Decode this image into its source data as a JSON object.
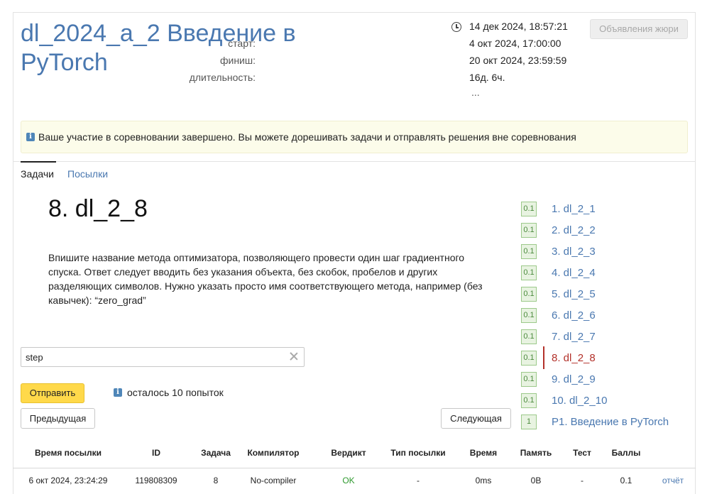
{
  "contest": {
    "title": "dl_2024_a_2 Введение в PyTorch",
    "now": "14 дек 2024, 18:57:21",
    "start_label": "старт:",
    "start": "4 окт 2024, 17:00:00",
    "finish_label": "финиш:",
    "finish": "20 окт 2024, 23:59:59",
    "duration_label": "длительность:",
    "duration": "16д. 6ч.",
    "ellipsis": "...",
    "jury_button": "Объявления жюри"
  },
  "alert": {
    "icon": "info-icon",
    "text": "Ваше участие в соревновании завершено. Вы можете дорешивать задачи и отправлять решения вне соревнования"
  },
  "tabs": {
    "tasks": "Задачи",
    "submissions": "Посылки"
  },
  "problem": {
    "title": "8. dl_2_8",
    "statement": "Впишите название метода оптимизатора, позволяющего провести один шаг градиентного спуска. Ответ следует вводить без указания объекта, без скобок, пробелов и других разделяющих символов. Нужно указать просто имя соответствующего метода, например (без кавычек): “zero_grad”",
    "answer_value": "step",
    "submit_label": "Отправить",
    "attempts_left": "осталось 10 попыток",
    "prev_label": "Предыдущая",
    "next_label": "Следующая"
  },
  "problem_list": [
    {
      "score": "0.1",
      "label": "1. dl_2_1"
    },
    {
      "score": "0.1",
      "label": "2. dl_2_2"
    },
    {
      "score": "0.1",
      "label": "3. dl_2_3"
    },
    {
      "score": "0.1",
      "label": "4. dl_2_4"
    },
    {
      "score": "0.1",
      "label": "5. dl_2_5"
    },
    {
      "score": "0.1",
      "label": "6. dl_2_6"
    },
    {
      "score": "0.1",
      "label": "7. dl_2_7"
    },
    {
      "score": "0.1",
      "label": "8. dl_2_8",
      "active": true
    },
    {
      "score": "0.1",
      "label": "9. dl_2_9"
    },
    {
      "score": "0.1",
      "label": "10. dl_2_10"
    },
    {
      "score": "1",
      "label": "P1. Введение в PyTorch"
    }
  ],
  "submissions_table": {
    "headers": [
      "Время посылки",
      "ID",
      "Задача",
      "Компилятор",
      "Вердикт",
      "Тип посылки",
      "Время",
      "Память",
      "Тест",
      "Баллы"
    ],
    "rows": [
      [
        "6 окт 2024, 23:24:29",
        "119808309",
        "8",
        "No-compiler",
        "OK",
        "-",
        "0ms",
        "0B",
        "-",
        "0.1",
        "отчёт"
      ]
    ]
  },
  "colors": {
    "link": "#4a78b0",
    "active": "#b3312a",
    "submit": "#ffd94a",
    "verdict_ok": "#2f9a2f",
    "alert_bg": "#fcfcea"
  }
}
